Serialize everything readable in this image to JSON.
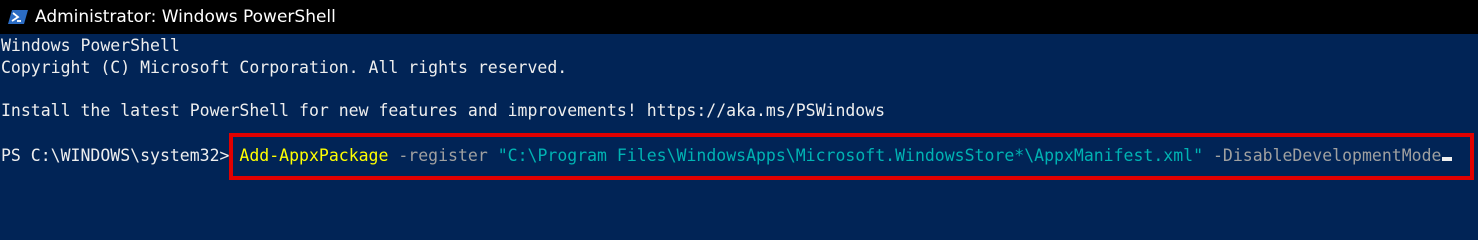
{
  "window": {
    "title": "Administrator: Windows PowerShell",
    "icon": "powershell-icon"
  },
  "console": {
    "lines": [
      "Windows PowerShell",
      "Copyright (C) Microsoft Corporation. All rights reserved.",
      "Install the latest PowerShell for new features and improvements! https://aka.ms/PSWindows"
    ],
    "prompt": "PS C:\\WINDOWS\\system32> ",
    "command": {
      "cmdlet": "Add-AppxPackage",
      "param1": " -register ",
      "path": "\"C:\\Program Files\\WindowsApps\\Microsoft.WindowsStore*\\AppxManifest.xml\"",
      "param2": " -DisableDevelopmentMode"
    }
  },
  "colors": {
    "background": "#012456",
    "titlebar": "#000000",
    "cmdlet": "#ffff00",
    "string": "#00b3b3",
    "parameter": "#a0a0a0",
    "highlight": "#e10000"
  }
}
